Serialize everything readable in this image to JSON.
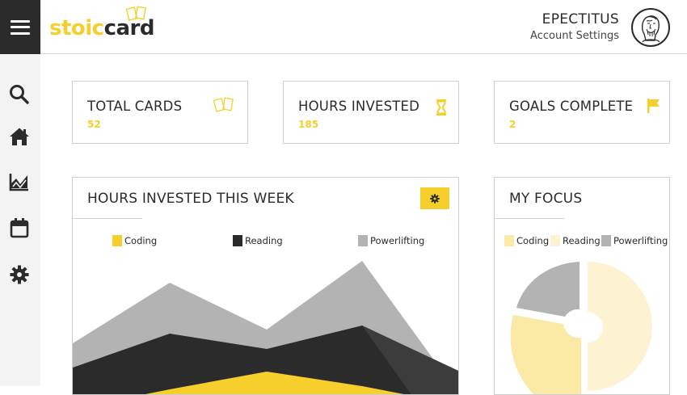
{
  "app": {
    "logo_main": "stoic",
    "logo_suffix": "ard",
    "logo_c": "c"
  },
  "header": {
    "user_name": "EPECTITUS",
    "user_sub": "Account Settings"
  },
  "sidebar": {
    "items": [
      {
        "icon": "search-icon"
      },
      {
        "icon": "home-icon"
      },
      {
        "icon": "chart-icon"
      },
      {
        "icon": "calendar-icon"
      },
      {
        "icon": "gear-icon"
      }
    ]
  },
  "stats": [
    {
      "title": "TOTAL CARDS",
      "value": "52",
      "icon": "cards-icon"
    },
    {
      "title": "HOURS INVESTED",
      "value": "185",
      "icon": "hourglass-icon"
    },
    {
      "title": "GOALS COMPLETE",
      "value": "2",
      "icon": "flag-icon"
    }
  ],
  "weekly_panel": {
    "title": "HOURS INVESTED THIS WEEK",
    "legend": [
      "Coding",
      "Reading",
      "Powerlifting"
    ]
  },
  "focus_panel": {
    "title": "MY FOCUS",
    "legend": [
      "Coding",
      "Reading",
      "Powerlifting"
    ]
  },
  "colors": {
    "accent": "#f6cf2d",
    "dark": "#2b2b2b",
    "grey": "#b3b3b3",
    "pale_yellow": "#fbe9a6",
    "cream": "#fdf3d2"
  },
  "chart_data": [
    {
      "type": "area",
      "title": "HOURS INVESTED THIS WEEK",
      "series": [
        {
          "name": "Powerlifting",
          "color": "#b3b3b3"
        },
        {
          "name": "Reading",
          "color": "#2b2b2b"
        },
        {
          "name": "Coding",
          "color": "#f6cf2d"
        }
      ]
    },
    {
      "type": "pie",
      "title": "MY FOCUS",
      "series": [
        {
          "name": "Coding",
          "color": "#fbe9a6"
        },
        {
          "name": "Reading",
          "color": "#fdf3d2"
        },
        {
          "name": "Powerlifting",
          "color": "#b3b3b3"
        }
      ]
    }
  ]
}
